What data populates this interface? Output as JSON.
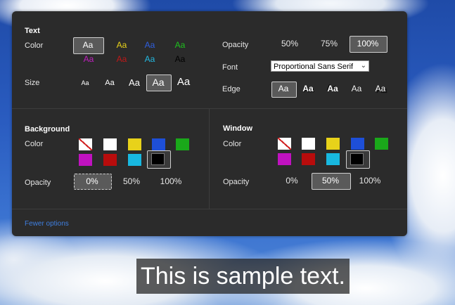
{
  "text_section": {
    "title": "Text",
    "color_label": "Color",
    "size_label": "Size",
    "sample_glyph": "Aa",
    "colors": [
      "#ffffff",
      "#e8d21a",
      "#2f5fe0",
      "#1ec21e",
      "#c020c0",
      "#c01818",
      "#23b8e0",
      "#000000"
    ],
    "opacity_label": "Opacity",
    "opacity_options": [
      "50%",
      "75%",
      "100%"
    ],
    "font_label": "Font",
    "font_value": "Proportional Sans Serif",
    "edge_label": "Edge"
  },
  "background_section": {
    "title": "Background",
    "color_label": "Color",
    "opacity_label": "Opacity",
    "opacity_options": [
      "0%",
      "50%",
      "100%"
    ]
  },
  "window_section": {
    "title": "Window",
    "color_label": "Color",
    "opacity_label": "Opacity",
    "opacity_options": [
      "0%",
      "50%",
      "100%"
    ]
  },
  "swatch_colors": [
    "none",
    "#ffffff",
    "#e8d21a",
    "#1e4fd8",
    "#1aa81a",
    "#c012c0",
    "#b80c0c",
    "#18b8e0",
    "#000000"
  ],
  "fewer_options": "Fewer options",
  "sample_text": "This is sample text."
}
